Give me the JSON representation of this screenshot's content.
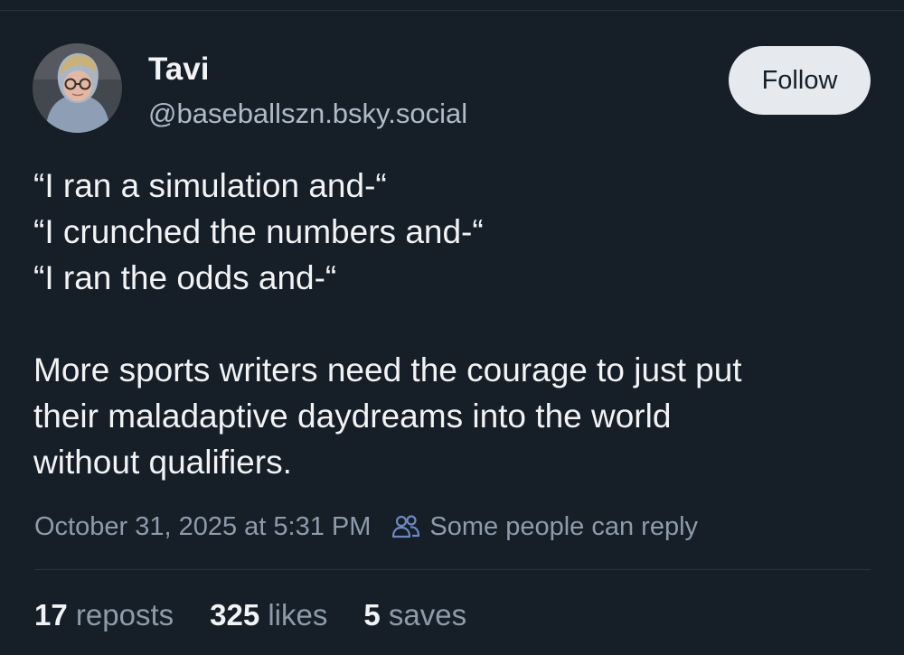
{
  "author": {
    "display_name": "Tavi",
    "handle": "@baseballszn.bsky.social"
  },
  "follow_button": {
    "label": "Follow"
  },
  "post": {
    "lines": [
      "“I ran a simulation and-“",
      "“I crunched the numbers and-“",
      "“I ran the odds and-“"
    ],
    "paragraph2": [
      "More sports writers need the courage to just put",
      "their maladaptive daydreams into the world",
      "without qualifiers."
    ]
  },
  "meta": {
    "timestamp": "October 31, 2025 at 5:31 PM",
    "reply_setting": "Some people can reply",
    "reply_icon": "people-icon"
  },
  "stats": {
    "reposts": {
      "count": "17",
      "label": "reposts"
    },
    "likes": {
      "count": "325",
      "label": "likes"
    },
    "saves": {
      "count": "5",
      "label": "saves"
    }
  },
  "colors": {
    "background": "#161e27",
    "primary_text": "#f1f3f5",
    "secondary_text": "#8d9bab",
    "follow_button_bg": "#e6e9ee"
  }
}
